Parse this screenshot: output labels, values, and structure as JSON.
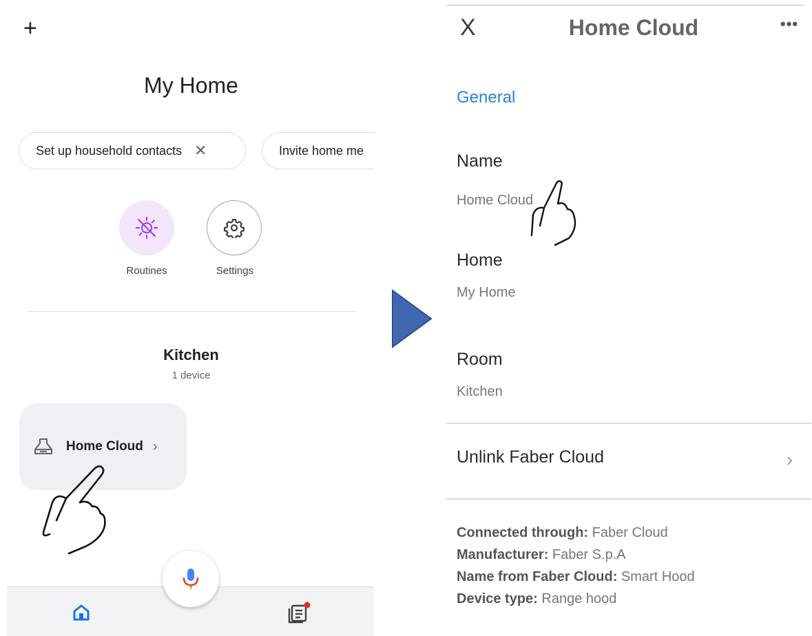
{
  "left_screen": {
    "plus_label": "+",
    "home_title": "My Home",
    "chips": [
      {
        "label": "Set up household contacts",
        "close": "✕"
      },
      {
        "label": "Invite home me"
      }
    ],
    "actions": [
      {
        "label": "Routines",
        "icon": "routines-icon"
      },
      {
        "label": "Settings",
        "icon": "gear-icon"
      }
    ],
    "room": {
      "title": "Kitchen",
      "device_count": "1 device"
    },
    "device": {
      "name": "Home Cloud",
      "chevron": "›",
      "icon": "range-hood-icon"
    },
    "bottom_nav": [
      "home-icon",
      "feed-icon"
    ],
    "accent_colors": {
      "routines_bg": "#f3e6fb",
      "routines_icon": "#a142f4",
      "home_tab": "#1a73e8",
      "badge": "#d93025"
    }
  },
  "right_screen": {
    "close_label": "X",
    "title": "Home Cloud",
    "more_label": "•••",
    "section": "General",
    "fields": [
      {
        "label": "Name",
        "value": "Home Cloud"
      },
      {
        "label": "Home",
        "value": "My Home"
      },
      {
        "label": "Room",
        "value": "Kitchen"
      }
    ],
    "unlink_label": "Unlink Faber Cloud",
    "unlink_chevron": "›",
    "info": [
      {
        "key": "Connected through:",
        "value": "Faber Cloud"
      },
      {
        "key": "Manufacturer:",
        "value": "Faber S.p.A"
      },
      {
        "key": "Name from Faber Cloud:",
        "value": "Smart Hood"
      },
      {
        "key": "Device type:",
        "value": "Range hood"
      }
    ],
    "accent_colors": {
      "section": "#2f7fdc"
    }
  },
  "arrow_color": "#3f68b0"
}
